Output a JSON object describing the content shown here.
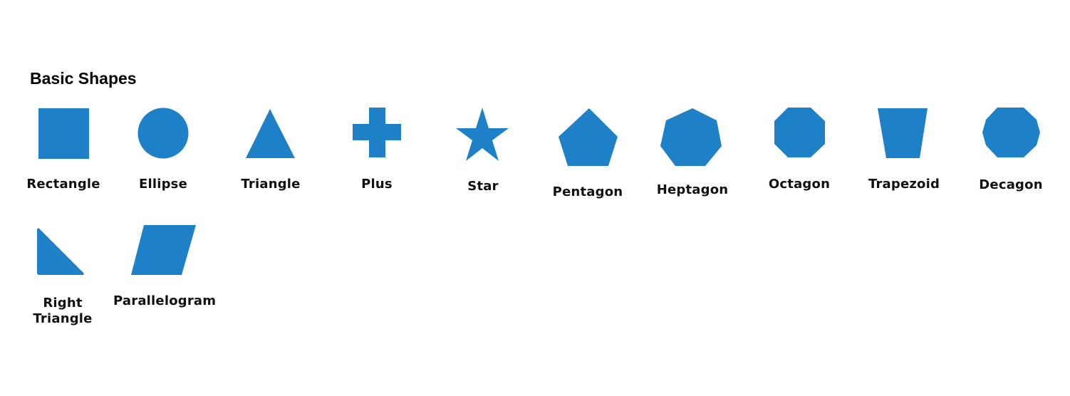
{
  "section_title": "Basic Shapes",
  "fill_color": "#1e81c7",
  "shapes": [
    {
      "id": "rectangle",
      "label": "Rectangle"
    },
    {
      "id": "ellipse",
      "label": "Ellipse"
    },
    {
      "id": "triangle",
      "label": "Triangle"
    },
    {
      "id": "plus",
      "label": "Plus"
    },
    {
      "id": "star",
      "label": "Star"
    },
    {
      "id": "pentagon",
      "label": "Pentagon"
    },
    {
      "id": "heptagon",
      "label": "Heptagon"
    },
    {
      "id": "octagon",
      "label": "Octagon"
    },
    {
      "id": "trapezoid",
      "label": "Trapezoid"
    },
    {
      "id": "decagon",
      "label": "Decagon"
    },
    {
      "id": "right-triangle",
      "label": "Right Triangle"
    },
    {
      "id": "parallelogram",
      "label": "Parallelogram"
    }
  ]
}
